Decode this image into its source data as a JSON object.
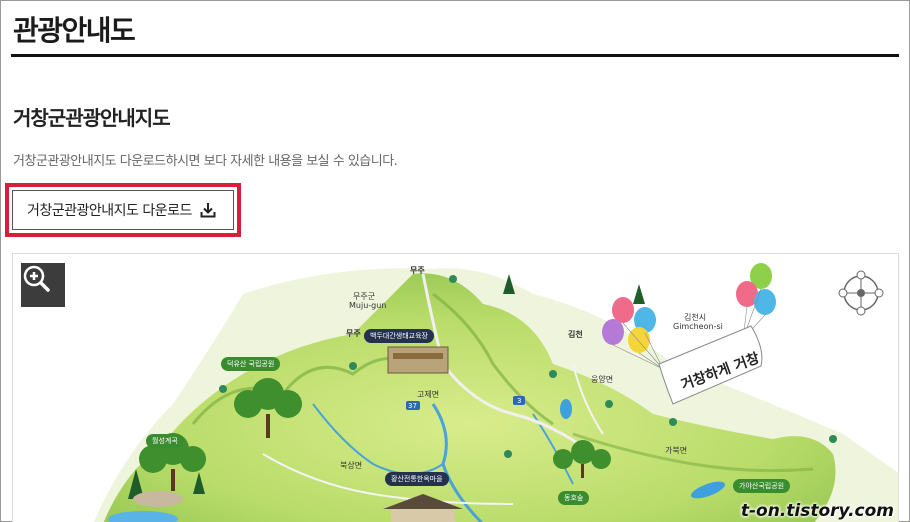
{
  "page": {
    "title": "관광안내도"
  },
  "section": {
    "title": "거창군관광안내지도",
    "description": "거창군관광안내지도 다운로드하시면 보다 자세한 내용을 보실 수 있습니다."
  },
  "download": {
    "label": "거창군관광안내지도 다운로드"
  },
  "map": {
    "labels": {
      "muju_top": "무주",
      "muju_gun_ko": "무주군",
      "muju_gun_en": "Muju-gun",
      "muju_left": "무주",
      "gimcheon": "김천",
      "gimcheon_si_ko": "김천시",
      "gimcheon_si_en": "Gimcheon-si",
      "gojemyeon": "고제면",
      "bukgamyeon": "북상면",
      "gabukmyeon": "가북면",
      "ungyangmyeon": "웅양면",
      "route_37": "37",
      "route_3": "3"
    },
    "tags": {
      "baekdu": "백두대간생태교육장",
      "deogyusan": "덕유산 국립공원",
      "hwanggang": "황산전통한옥마을",
      "wolseong": "월성계곡",
      "gaya": "가야산국립공원",
      "dongho": "동호숲"
    },
    "slogan": "거창하게 거창"
  },
  "watermark": "t-on.tistory.com",
  "icons": {
    "zoom": "zoom-in-icon",
    "download": "download-icon",
    "compass": "compass-icon"
  }
}
